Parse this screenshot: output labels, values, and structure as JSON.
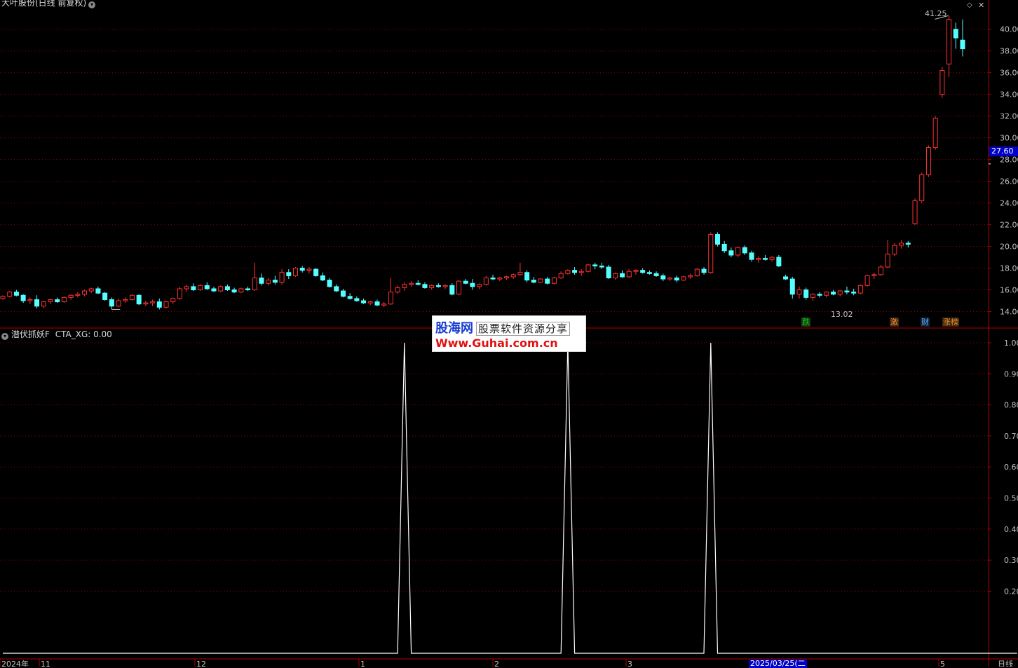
{
  "header": {
    "title": "大叶股份(日线 前复权)",
    "indicator_label": "潜伏抓妖F",
    "indicator_value": "CTA_XG: 0.00"
  },
  "price_panel": {
    "current_price_label": "27.60",
    "high_label": "41.25",
    "low_label": "13.02",
    "badges": [
      {
        "text": "跌",
        "color": "#00c000"
      },
      {
        "text": "激",
        "color": "#e08020"
      },
      {
        "text": "财",
        "color": "#4aa8ff"
      },
      {
        "text": "涨榜",
        "color": "#e08020"
      }
    ]
  },
  "x_axis": {
    "labels": [
      "2024年",
      "11",
      "12",
      "1",
      "2",
      "3",
      "2025/03/25(二",
      "5"
    ],
    "period_label": "日线"
  },
  "watermark": {
    "line1": "股海网",
    "line1_tag": "股票软件资源分享",
    "line2": "Www.Guhai.com.cn"
  },
  "colors": {
    "up": "#ff3232",
    "down": "#54ffff",
    "grid": "#8b0000",
    "indicator_line": "#ffffff"
  },
  "chart_data": [
    {
      "type": "candlestick",
      "title": "大叶股份(日线 前复权)",
      "y_ticks": [
        14,
        16,
        18,
        20,
        22,
        24,
        26,
        28,
        30,
        32,
        34,
        36,
        38,
        40
      ],
      "y_tick_labels": [
        "14.00",
        "16.00",
        "18.00",
        "20.00",
        "22.00",
        "24.00",
        "26.00",
        "28.00",
        "30.00",
        "32.00",
        "34.00",
        "36.00",
        "38.00",
        "40.00"
      ],
      "ylim": [
        13.0,
        42.5
      ],
      "ohlc": [
        [
          15.2,
          15.5,
          15.1,
          15.4
        ],
        [
          15.4,
          15.9,
          15.3,
          15.8
        ],
        [
          15.8,
          16.0,
          15.4,
          15.5
        ],
        [
          15.5,
          15.6,
          14.8,
          15.0
        ],
        [
          15.0,
          15.3,
          14.7,
          15.1
        ],
        [
          15.1,
          15.5,
          14.3,
          14.5
        ],
        [
          14.5,
          15.0,
          14.3,
          14.9
        ],
        [
          14.9,
          15.2,
          14.7,
          15.1
        ],
        [
          15.1,
          15.3,
          14.8,
          14.9
        ],
        [
          14.9,
          15.4,
          14.8,
          15.3
        ],
        [
          15.3,
          15.6,
          15.1,
          15.5
        ],
        [
          15.5,
          15.8,
          15.3,
          15.6
        ],
        [
          15.6,
          16.0,
          15.4,
          15.9
        ],
        [
          15.9,
          16.2,
          15.7,
          16.1
        ],
        [
          16.1,
          16.3,
          15.6,
          15.7
        ],
        [
          15.7,
          15.8,
          15.0,
          15.1
        ],
        [
          15.1,
          15.3,
          14.2,
          14.5
        ],
        [
          14.5,
          15.2,
          14.4,
          15.0
        ],
        [
          15.0,
          15.3,
          14.8,
          15.1
        ],
        [
          15.1,
          15.6,
          15.0,
          15.5
        ],
        [
          15.5,
          15.6,
          14.6,
          14.7
        ],
        [
          14.7,
          15.0,
          14.5,
          14.8
        ],
        [
          14.8,
          15.1,
          14.5,
          14.9
        ],
        [
          14.9,
          15.2,
          14.2,
          14.4
        ],
        [
          14.4,
          15.0,
          14.3,
          14.9
        ],
        [
          14.9,
          15.3,
          14.7,
          15.2
        ],
        [
          15.2,
          16.3,
          15.1,
          16.1
        ],
        [
          16.1,
          16.5,
          15.8,
          16.3
        ],
        [
          16.3,
          16.6,
          15.9,
          16.0
        ],
        [
          16.0,
          16.5,
          15.9,
          16.4
        ],
        [
          16.4,
          16.7,
          16.0,
          16.1
        ],
        [
          16.1,
          16.3,
          15.8,
          15.9
        ],
        [
          15.9,
          16.4,
          15.8,
          16.3
        ],
        [
          16.3,
          16.5,
          15.9,
          16.0
        ],
        [
          16.0,
          16.2,
          15.7,
          15.8
        ],
        [
          15.8,
          16.2,
          15.7,
          16.1
        ],
        [
          16.1,
          16.3,
          15.9,
          16.0
        ],
        [
          16.0,
          18.5,
          15.9,
          17.1
        ],
        [
          17.1,
          17.5,
          16.4,
          16.6
        ],
        [
          16.6,
          17.1,
          16.4,
          16.9
        ],
        [
          16.9,
          17.3,
          16.5,
          16.7
        ],
        [
          16.7,
          17.9,
          16.5,
          17.6
        ],
        [
          17.6,
          17.9,
          17.0,
          17.3
        ],
        [
          17.3,
          18.1,
          17.2,
          18.0
        ],
        [
          18.0,
          18.2,
          17.6,
          17.8
        ],
        [
          17.8,
          18.1,
          17.5,
          17.9
        ],
        [
          17.9,
          18.0,
          17.2,
          17.3
        ],
        [
          17.3,
          17.6,
          16.8,
          16.9
        ],
        [
          16.9,
          17.1,
          16.2,
          16.3
        ],
        [
          16.3,
          16.5,
          15.8,
          15.9
        ],
        [
          15.9,
          16.1,
          15.3,
          15.4
        ],
        [
          15.4,
          15.7,
          15.1,
          15.2
        ],
        [
          15.2,
          15.4,
          14.9,
          15.0
        ],
        [
          15.0,
          15.2,
          14.7,
          14.8
        ],
        [
          14.8,
          15.0,
          14.6,
          14.9
        ],
        [
          14.9,
          15.1,
          14.5,
          14.6
        ],
        [
          14.6,
          14.9,
          14.4,
          14.7
        ],
        [
          14.7,
          17.1,
          14.6,
          15.8
        ],
        [
          15.8,
          16.4,
          15.6,
          16.2
        ],
        [
          16.2,
          16.7,
          15.9,
          16.5
        ],
        [
          16.5,
          16.8,
          16.3,
          16.6
        ],
        [
          16.6,
          16.9,
          16.4,
          16.5
        ],
        [
          16.5,
          16.7,
          16.1,
          16.2
        ],
        [
          16.2,
          16.5,
          16.0,
          16.4
        ],
        [
          16.4,
          16.6,
          16.2,
          16.3
        ],
        [
          16.3,
          16.5,
          16.1,
          16.4
        ],
        [
          16.4,
          16.6,
          15.5,
          15.6
        ],
        [
          15.6,
          16.9,
          15.5,
          16.8
        ],
        [
          16.8,
          17.0,
          16.5,
          16.6
        ],
        [
          16.6,
          17.0,
          16.0,
          16.3
        ],
        [
          16.3,
          16.6,
          16.1,
          16.5
        ],
        [
          16.5,
          17.3,
          16.4,
          17.1
        ],
        [
          17.1,
          17.4,
          16.9,
          17.0
        ],
        [
          17.0,
          17.2,
          16.8,
          17.1
        ],
        [
          17.1,
          17.3,
          16.9,
          17.2
        ],
        [
          17.2,
          17.5,
          17.0,
          17.4
        ],
        [
          17.4,
          18.5,
          17.3,
          17.6
        ],
        [
          17.6,
          17.8,
          16.7,
          16.9
        ],
        [
          16.9,
          17.2,
          16.6,
          16.7
        ],
        [
          16.7,
          17.1,
          16.6,
          17.0
        ],
        [
          17.0,
          17.2,
          16.5,
          16.6
        ],
        [
          16.6,
          17.2,
          16.5,
          17.1
        ],
        [
          17.1,
          17.7,
          17.0,
          17.5
        ],
        [
          17.5,
          17.9,
          17.4,
          17.8
        ],
        [
          17.8,
          18.1,
          17.4,
          17.6
        ],
        [
          17.6,
          17.9,
          17.3,
          17.7
        ],
        [
          17.7,
          18.4,
          17.6,
          18.3
        ],
        [
          18.3,
          18.5,
          17.9,
          18.2
        ],
        [
          18.2,
          18.5,
          17.9,
          18.1
        ],
        [
          18.1,
          18.3,
          17.0,
          17.1
        ],
        [
          17.1,
          17.6,
          16.9,
          17.5
        ],
        [
          17.5,
          17.8,
          17.1,
          17.2
        ],
        [
          17.2,
          17.9,
          17.1,
          17.7
        ],
        [
          17.7,
          17.9,
          17.4,
          17.8
        ],
        [
          17.8,
          18.0,
          17.5,
          17.6
        ],
        [
          17.6,
          17.8,
          17.4,
          17.5
        ],
        [
          17.5,
          17.7,
          17.2,
          17.3
        ],
        [
          17.3,
          17.5,
          16.8,
          17.0
        ],
        [
          17.0,
          17.2,
          16.8,
          17.1
        ],
        [
          17.1,
          17.3,
          16.7,
          16.9
        ],
        [
          16.9,
          17.3,
          16.8,
          17.2
        ],
        [
          17.2,
          17.5,
          17.0,
          17.3
        ],
        [
          17.3,
          18.0,
          17.2,
          17.9
        ],
        [
          17.9,
          18.1,
          17.4,
          17.6
        ],
        [
          17.6,
          21.3,
          17.5,
          21.1
        ],
        [
          21.1,
          21.3,
          20.0,
          20.2
        ],
        [
          20.2,
          20.5,
          19.4,
          19.6
        ],
        [
          19.6,
          19.9,
          19.0,
          19.2
        ],
        [
          19.2,
          20.0,
          19.0,
          19.9
        ],
        [
          19.9,
          20.1,
          19.2,
          19.4
        ],
        [
          19.4,
          19.6,
          18.6,
          18.8
        ],
        [
          18.8,
          19.1,
          18.5,
          18.9
        ],
        [
          18.9,
          19.2,
          18.7,
          18.8
        ],
        [
          18.8,
          19.1,
          18.6,
          19.0
        ],
        [
          19.0,
          19.2,
          18.1,
          18.2
        ],
        [
          17.2,
          17.4,
          16.9,
          17.0
        ],
        [
          17.0,
          17.2,
          15.2,
          15.6
        ],
        [
          15.6,
          16.3,
          15.2,
          16.0
        ],
        [
          16.0,
          16.2,
          15.1,
          15.3
        ],
        [
          15.3,
          15.7,
          15.0,
          15.6
        ],
        [
          15.6,
          15.8,
          15.3,
          15.5
        ],
        [
          15.5,
          15.9,
          15.3,
          15.8
        ],
        [
          15.8,
          16.0,
          15.5,
          15.6
        ],
        [
          15.6,
          16.0,
          15.4,
          15.9
        ],
        [
          15.9,
          16.3,
          15.6,
          15.8
        ],
        [
          15.8,
          16.1,
          15.5,
          15.7
        ],
        [
          15.7,
          16.5,
          15.6,
          16.4
        ],
        [
          16.4,
          17.4,
          16.3,
          17.3
        ],
        [
          17.3,
          17.6,
          17.0,
          17.4
        ],
        [
          17.4,
          18.3,
          17.3,
          18.1
        ],
        [
          18.1,
          20.6,
          18.0,
          19.3
        ],
        [
          19.3,
          20.3,
          19.1,
          20.1
        ],
        [
          20.1,
          20.6,
          19.8,
          20.3
        ],
        [
          20.3,
          20.5,
          19.9,
          20.2
        ],
        [
          22.1,
          24.4,
          22.0,
          24.2
        ],
        [
          24.2,
          26.8,
          24.0,
          26.6
        ],
        [
          26.6,
          29.3,
          26.4,
          29.1
        ],
        [
          29.1,
          32.0,
          28.9,
          31.8
        ],
        [
          34.0,
          36.5,
          33.7,
          36.2
        ],
        [
          36.8,
          41.25,
          35.6,
          40.9
        ],
        [
          40.0,
          40.6,
          38.2,
          39.2
        ],
        [
          39.0,
          40.9,
          37.5,
          38.2
        ]
      ]
    },
    {
      "type": "line",
      "title": "潜伏抓妖F",
      "series": [
        {
          "name": "CTA_XG",
          "values": [
            0,
            0,
            0,
            0,
            0,
            0,
            0,
            0,
            0,
            0,
            0,
            0,
            0,
            0,
            0,
            0,
            0,
            0,
            0,
            0,
            0,
            0,
            0,
            0,
            0,
            0,
            0,
            0,
            0,
            0,
            0,
            0,
            0,
            0,
            0,
            0,
            0,
            0,
            0,
            0,
            0,
            0,
            0,
            0,
            0,
            0,
            0,
            0,
            0,
            0,
            0,
            0,
            0,
            0,
            0,
            0,
            0,
            0,
            0,
            1,
            0,
            0,
            0,
            0,
            0,
            0,
            0,
            0,
            0,
            0,
            0,
            0,
            0,
            0,
            0,
            0,
            0,
            0,
            0,
            0,
            0,
            0,
            0,
            1,
            0,
            0,
            0,
            0,
            0,
            0,
            0,
            0,
            0,
            0,
            0,
            0,
            0,
            0,
            0,
            0,
            0,
            0,
            0,
            0,
            1,
            0,
            0,
            0,
            0,
            0,
            0,
            0,
            0,
            0,
            0,
            0,
            0,
            0,
            0,
            0,
            0,
            0,
            0,
            0,
            0,
            0,
            0,
            0,
            0,
            0,
            0,
            0,
            0,
            0,
            0,
            0,
            0,
            0,
            0,
            0,
            0,
            0,
            0,
            0,
            0,
            0,
            0,
            0,
            0,
            0
          ]
        }
      ],
      "y_ticks": [
        0.2,
        0.3,
        0.4,
        0.5,
        0.6,
        0.7,
        0.8,
        0.9,
        1.0
      ],
      "y_tick_labels": [
        "0.20",
        "0.30",
        "0.40",
        "0.50",
        "0.60",
        "0.70",
        "0.80",
        "0.90",
        "1.00"
      ],
      "ylim": [
        0,
        1.0
      ]
    }
  ]
}
